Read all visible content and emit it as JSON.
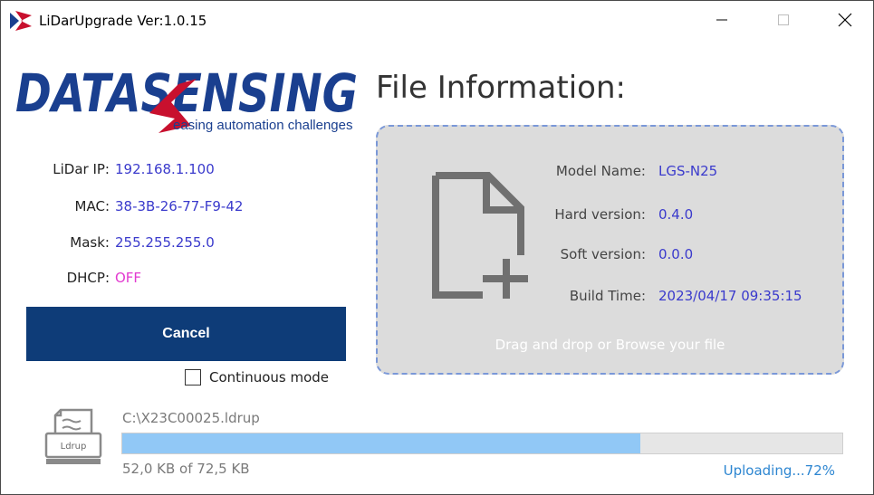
{
  "window": {
    "title": "LiDarUpgrade  Ver:1.0.15"
  },
  "logo": {
    "brand": "DATASENSING",
    "tagline": "easing automation challenges",
    "colors": {
      "primary": "#1a3f8f",
      "accent": "#c8102e"
    }
  },
  "file_info": {
    "heading": "File Information:",
    "model_label": "Model Name:",
    "model_value": "LGS-N25",
    "hard_label": "Hard version:",
    "hard_value": "0.4.0",
    "soft_label": "Soft version:",
    "soft_value": "0.0.0",
    "build_label": "Build Time:",
    "build_value": "2023/04/17 09:35:15",
    "drop_hint": "Drag and drop or Browse your file"
  },
  "network": {
    "ip_label": "LiDar IP:",
    "ip_value": "192.168.1.100",
    "mac_label": "MAC:",
    "mac_value": "38-3B-26-77-F9-42",
    "mask_label": "Mask:",
    "mask_value": "255.255.255.0",
    "dhcp_label": "DHCP:",
    "dhcp_value": "OFF"
  },
  "controls": {
    "cancel_label": "Cancel",
    "continuous_label": "Continuous mode",
    "continuous_checked": false
  },
  "upload": {
    "icon_label": "Ldrup",
    "file_path": "C:\\X23C00025.ldrup",
    "size_text": "52,0 KB of 72,5 KB",
    "status_text": "Uploading...72%",
    "progress_percent": 72
  }
}
